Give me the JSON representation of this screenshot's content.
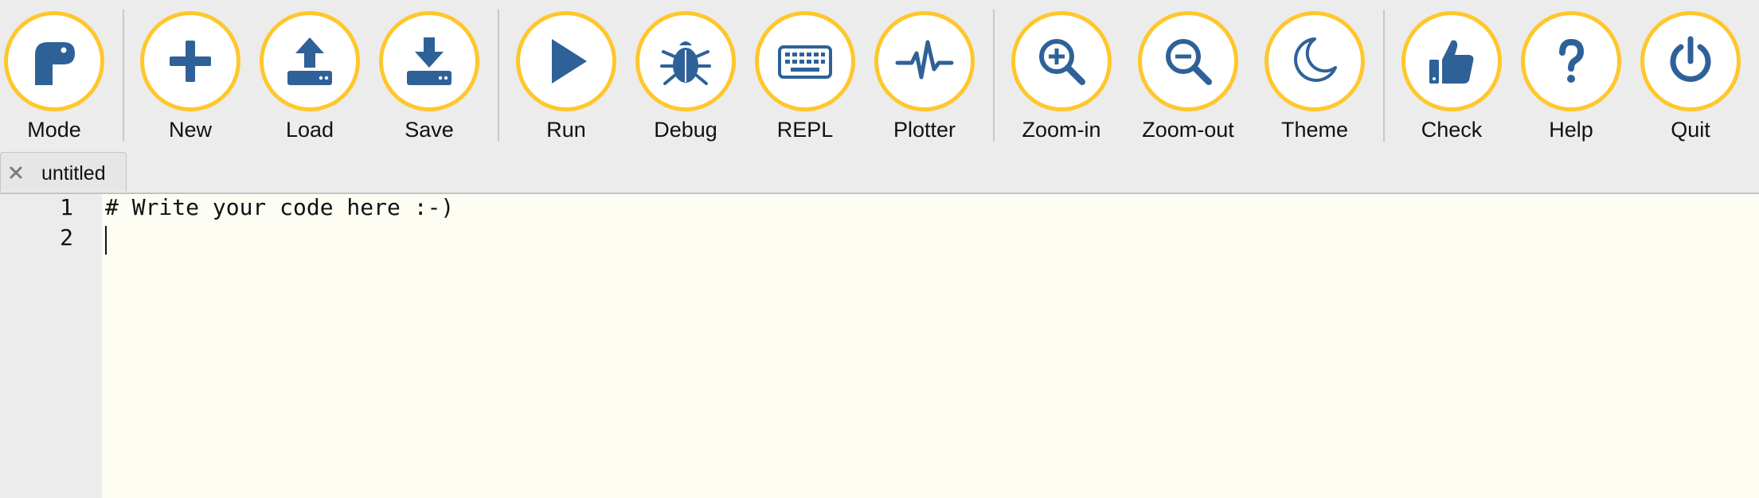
{
  "colors": {
    "ring": "#ffc72c",
    "icon": "#2f6199",
    "toolbar_bg": "#ececec",
    "editor_bg": "#fdfdf4"
  },
  "toolbar": {
    "mode": {
      "label": "Mode",
      "icon": "python-mode-icon"
    },
    "new": {
      "label": "New",
      "icon": "plus-icon"
    },
    "load": {
      "label": "Load",
      "icon": "upload-icon"
    },
    "save": {
      "label": "Save",
      "icon": "download-icon"
    },
    "run": {
      "label": "Run",
      "icon": "play-icon"
    },
    "debug": {
      "label": "Debug",
      "icon": "bug-icon"
    },
    "repl": {
      "label": "REPL",
      "icon": "keyboard-icon"
    },
    "plotter": {
      "label": "Plotter",
      "icon": "pulse-icon"
    },
    "zoom_in": {
      "label": "Zoom-in",
      "icon": "zoom-in-icon"
    },
    "zoom_out": {
      "label": "Zoom-out",
      "icon": "zoom-out-icon"
    },
    "theme": {
      "label": "Theme",
      "icon": "moon-icon"
    },
    "check": {
      "label": "Check",
      "icon": "thumbs-up-icon"
    },
    "help": {
      "label": "Help",
      "icon": "question-icon"
    },
    "quit": {
      "label": "Quit",
      "icon": "power-icon"
    }
  },
  "tab": {
    "label": "untitled",
    "close_icon": "close-icon"
  },
  "editor": {
    "lines": [
      {
        "number": "1",
        "text": "# Write your code here :-)"
      },
      {
        "number": "2",
        "text": ""
      }
    ]
  }
}
